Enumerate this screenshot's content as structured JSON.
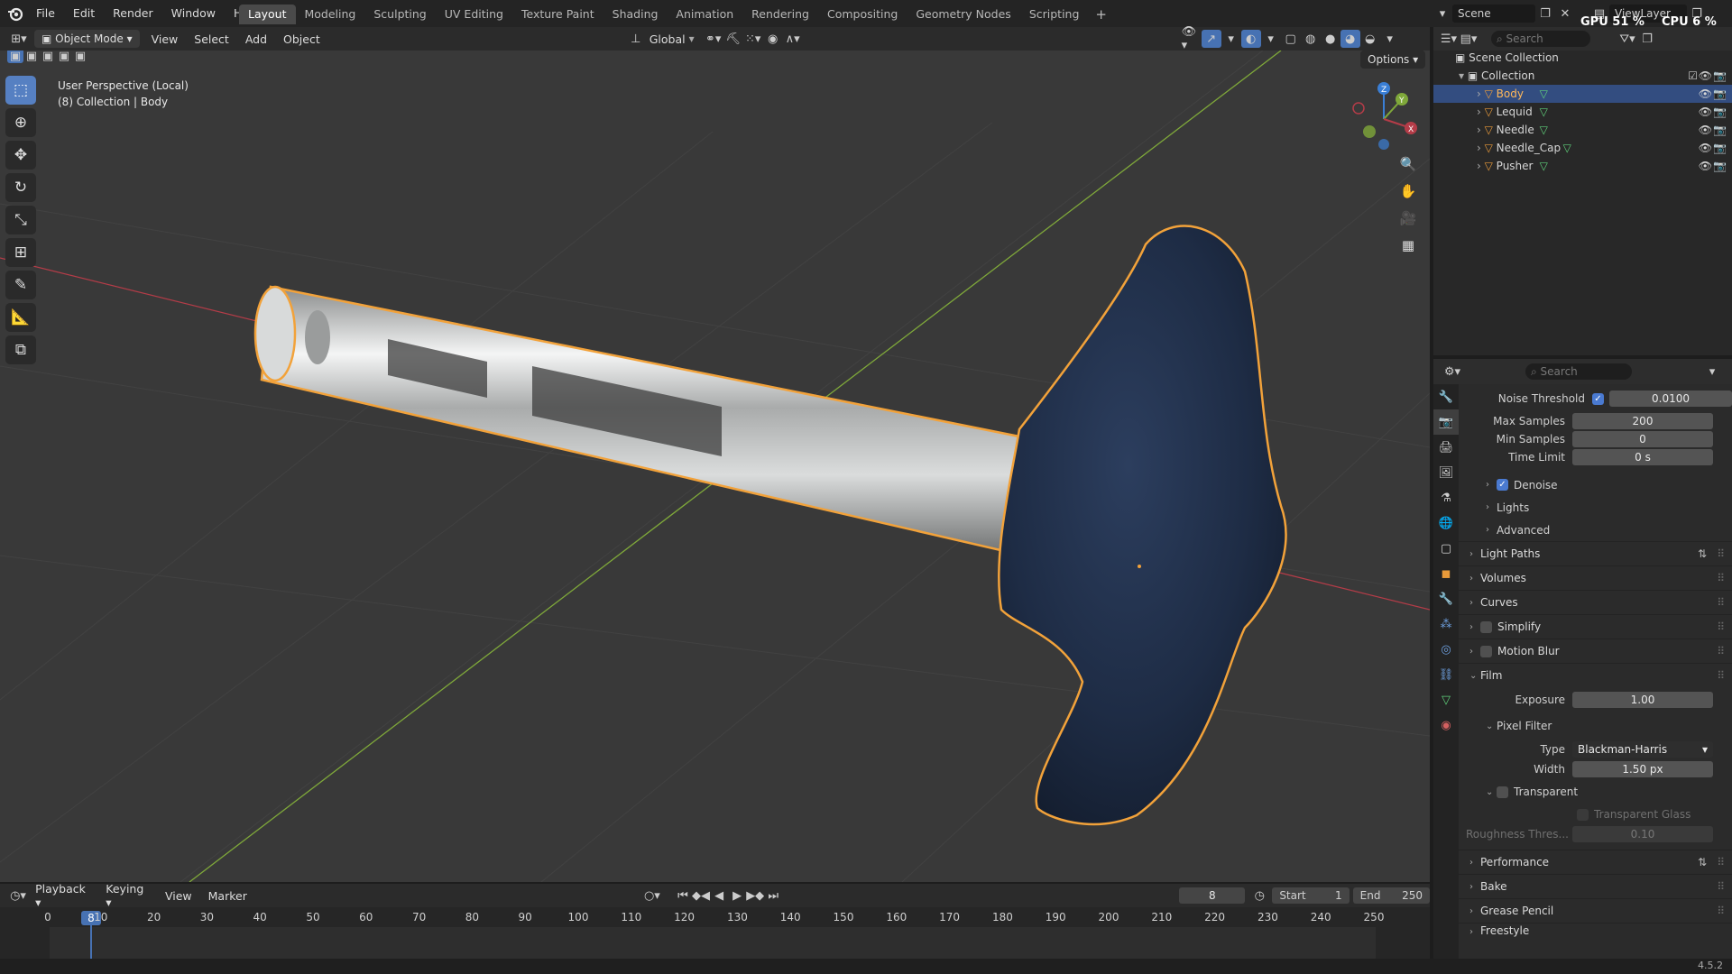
{
  "topbar": {
    "menu": [
      "File",
      "Edit",
      "Render",
      "Window",
      "Help"
    ],
    "workspace_tabs": [
      "Layout",
      "Modeling",
      "Sculpting",
      "UV Editing",
      "Texture Paint",
      "Shading",
      "Animation",
      "Rendering",
      "Compositing",
      "Geometry Nodes",
      "Scripting"
    ],
    "active_tab": "Layout",
    "scene_name": "Scene",
    "view_layer": "ViewLayer",
    "gpu": "GPU 51 %",
    "cpu": "CPU 6 %"
  },
  "viewport_header": {
    "mode": "Object Mode",
    "menus": [
      "View",
      "Select",
      "Add",
      "Object"
    ],
    "orientation": "Global",
    "options": "Options"
  },
  "viewport": {
    "perspective": "User Perspective (Local)",
    "context": "(8) Collection | Body",
    "axis_labels": [
      "Z",
      "Y",
      "X"
    ],
    "colors": {
      "x_axis": "#b43c48",
      "y_axis": "#7fa83a",
      "z_axis": "#3a7fd6",
      "selection_outline": "#f2a23a",
      "handle": "#1e2c45",
      "metal": "#c7c9c9",
      "background": "#393939"
    }
  },
  "outliner": {
    "search_placeholder": "Search",
    "root": "Scene Collection",
    "collection": "Collection",
    "objects": [
      {
        "name": "Body",
        "selected": true
      },
      {
        "name": "Lequid",
        "selected": false
      },
      {
        "name": "Needle",
        "selected": false
      },
      {
        "name": "Needle_Cap",
        "selected": false
      },
      {
        "name": "Pusher",
        "selected": false
      }
    ]
  },
  "properties": {
    "search_placeholder": "Search",
    "noise_threshold_label": "Noise Threshold",
    "noise_threshold": "0.0100",
    "max_samples_label": "Max Samples",
    "max_samples": "200",
    "min_samples_label": "Min Samples",
    "min_samples": "0",
    "time_limit_label": "Time Limit",
    "time_limit": "0 s",
    "denoise": "Denoise",
    "lights": "Lights",
    "advanced": "Advanced",
    "light_paths": "Light Paths",
    "volumes": "Volumes",
    "curves": "Curves",
    "simplify": "Simplify",
    "motion_blur": "Motion Blur",
    "film": "Film",
    "exposure_label": "Exposure",
    "exposure": "1.00",
    "pixel_filter": "Pixel Filter",
    "type_label": "Type",
    "type_value": "Blackman-Harris",
    "width_label": "Width",
    "width_value": "1.50 px",
    "transparent": "Transparent",
    "transparent_glass": "Transparent Glass",
    "roughness_label": "Roughness Thres...",
    "roughness_value": "0.10",
    "performance": "Performance",
    "bake": "Bake",
    "grease_pencil": "Grease Pencil",
    "freestyle": "Freestyle"
  },
  "timeline": {
    "menus": [
      "Playback",
      "Keying",
      "View",
      "Marker"
    ],
    "current_frame": "8",
    "start_label": "Start",
    "start": "1",
    "end_label": "End",
    "end": "250",
    "ticks": [
      "0",
      "10",
      "20",
      "30",
      "40",
      "50",
      "60",
      "70",
      "80",
      "90",
      "100",
      "110",
      "120",
      "130",
      "140",
      "150",
      "160",
      "170",
      "180",
      "190",
      "200",
      "210",
      "220",
      "230",
      "240",
      "250"
    ]
  },
  "statusbar": {
    "version": "4.5.2"
  }
}
